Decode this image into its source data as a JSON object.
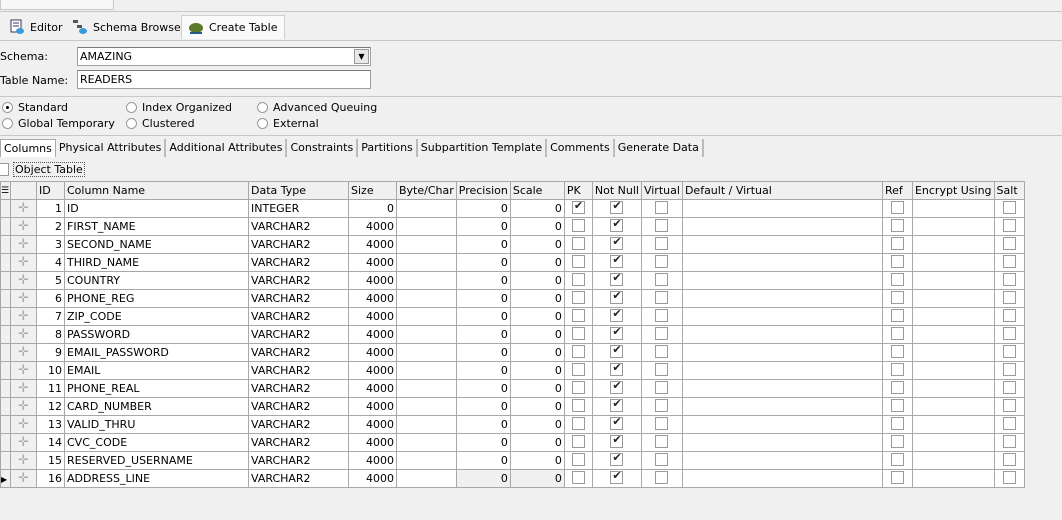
{
  "toolbar": {
    "tabs": [
      {
        "label": "Editor",
        "icon": "editor-icon"
      },
      {
        "label": "Schema Browser",
        "icon": "schema-browser-icon"
      },
      {
        "label": "Create Table",
        "icon": "toad-icon",
        "active": true
      }
    ]
  },
  "form": {
    "schema_label": "Schema:",
    "schema_value": "AMAZING",
    "table_name_label": "Table Name:",
    "table_name_value": "READERS"
  },
  "table_types": [
    {
      "label": "Standard",
      "selected": true
    },
    {
      "label": "Index Organized"
    },
    {
      "label": "Advanced Queuing"
    },
    {
      "label": "Global Temporary"
    },
    {
      "label": "Clustered"
    },
    {
      "label": "External"
    }
  ],
  "subtabs": [
    "Columns",
    "Physical Attributes",
    "Additional Attributes",
    "Constraints",
    "Partitions",
    "Subpartition Template",
    "Comments",
    "Generate Data"
  ],
  "object_table": {
    "label": "Object Table",
    "checked": false
  },
  "grid": {
    "headers": [
      "ID",
      "Column Name",
      "Data Type",
      "Size",
      "Byte/Char",
      "Precision",
      "Scale",
      "PK",
      "Not Null",
      "Virtual",
      "Default / Virtual",
      "Ref",
      "Encrypt Using",
      "Salt"
    ],
    "rows": [
      {
        "id": "1",
        "name": "ID",
        "type": "INTEGER",
        "size": "0",
        "precision": "0",
        "scale": "0",
        "pk": true,
        "notnull": true
      },
      {
        "id": "2",
        "name": "FIRST_NAME",
        "type": "VARCHAR2",
        "size": "4000",
        "precision": "0",
        "scale": "0",
        "pk": false,
        "notnull": true
      },
      {
        "id": "3",
        "name": "SECOND_NAME",
        "type": "VARCHAR2",
        "size": "4000",
        "precision": "0",
        "scale": "0",
        "pk": false,
        "notnull": true
      },
      {
        "id": "4",
        "name": "THIRD_NAME",
        "type": "VARCHAR2",
        "size": "4000",
        "precision": "0",
        "scale": "0",
        "pk": false,
        "notnull": true
      },
      {
        "id": "5",
        "name": "COUNTRY",
        "type": "VARCHAR2",
        "size": "4000",
        "precision": "0",
        "scale": "0",
        "pk": false,
        "notnull": true
      },
      {
        "id": "6",
        "name": "PHONE_REG",
        "type": "VARCHAR2",
        "size": "4000",
        "precision": "0",
        "scale": "0",
        "pk": false,
        "notnull": true
      },
      {
        "id": "7",
        "name": "ZIP_CODE",
        "type": "VARCHAR2",
        "size": "4000",
        "precision": "0",
        "scale": "0",
        "pk": false,
        "notnull": true
      },
      {
        "id": "8",
        "name": "PASSWORD",
        "type": "VARCHAR2",
        "size": "4000",
        "precision": "0",
        "scale": "0",
        "pk": false,
        "notnull": true
      },
      {
        "id": "9",
        "name": "EMAIL_PASSWORD",
        "type": "VARCHAR2",
        "size": "4000",
        "precision": "0",
        "scale": "0",
        "pk": false,
        "notnull": true
      },
      {
        "id": "10",
        "name": "EMAIL",
        "type": "VARCHAR2",
        "size": "4000",
        "precision": "0",
        "scale": "0",
        "pk": false,
        "notnull": true
      },
      {
        "id": "11",
        "name": "PHONE_REAL",
        "type": "VARCHAR2",
        "size": "4000",
        "precision": "0",
        "scale": "0",
        "pk": false,
        "notnull": true
      },
      {
        "id": "12",
        "name": "CARD_NUMBER",
        "type": "VARCHAR2",
        "size": "4000",
        "precision": "0",
        "scale": "0",
        "pk": false,
        "notnull": true
      },
      {
        "id": "13",
        "name": "VALID_THRU",
        "type": "VARCHAR2",
        "size": "4000",
        "precision": "0",
        "scale": "0",
        "pk": false,
        "notnull": true
      },
      {
        "id": "14",
        "name": "CVC_CODE",
        "type": "VARCHAR2",
        "size": "4000",
        "precision": "0",
        "scale": "0",
        "pk": false,
        "notnull": true
      },
      {
        "id": "15",
        "name": "RESERVED_USERNAME",
        "type": "VARCHAR2",
        "size": "4000",
        "precision": "0",
        "scale": "0",
        "pk": false,
        "notnull": true
      },
      {
        "id": "16",
        "name": "ADDRESS_LINE",
        "type": "VARCHAR2",
        "size": "4000",
        "precision": "0",
        "scale": "0",
        "pk": false,
        "notnull": true,
        "current": true
      }
    ]
  }
}
